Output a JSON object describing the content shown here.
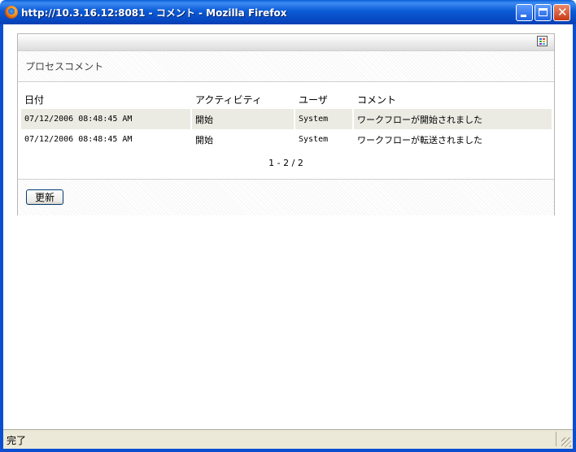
{
  "window": {
    "title": "http://10.3.16.12:8081 - コメント - Mozilla Firefox"
  },
  "panel": {
    "title": "プロセスコメント",
    "columns": [
      "日付",
      "アクティビティ",
      "ユーザ",
      "コメント"
    ],
    "rows": [
      {
        "date": "07/12/2006 08:48:45 AM",
        "activity": "開始",
        "user": "System",
        "comment": "ワークフローが開始されました"
      },
      {
        "date": "07/12/2006 08:48:45 AM",
        "activity": "開始",
        "user": "System",
        "comment": "ワークフローが転送されました"
      }
    ],
    "pager": "1 - 2 / 2",
    "refresh_label": "更新"
  },
  "status": {
    "text": "完了"
  },
  "colors": {
    "titlebar": "#0b5bd6",
    "row_alt": "#ebebe4",
    "statusbar": "#ece9d8"
  }
}
